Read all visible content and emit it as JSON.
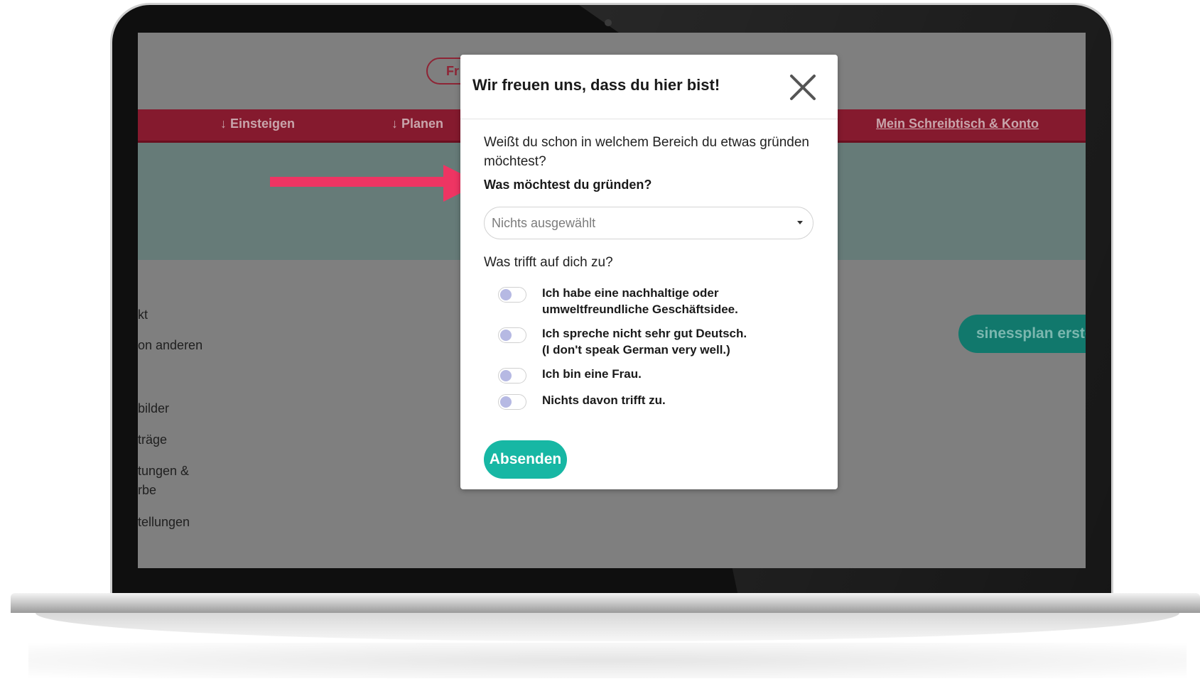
{
  "background_page": {
    "pill_fragment": "Fr",
    "nav": {
      "einsteigen": "↓ Einsteigen",
      "planen": "↓ Planen",
      "account": "Mein Schreibtisch & Konto"
    },
    "side_texts": [
      "kt",
      "on anderen",
      "bilder",
      "träge",
      "tungen &",
      "rbe",
      "tellungen"
    ],
    "cta_fragment": "sinessplan erstellen"
  },
  "modal": {
    "title": "Wir freuen uns, dass du hier bist!",
    "question": "Weißt du schon in welchem Bereich du etwas gründen möchtest?",
    "select_label": "Was möchtest du gründen?",
    "select_value": "Nichts ausgewählt",
    "section_label": "Was trifft auf dich zu?",
    "options": [
      "Ich habe eine nachhaltige oder\numweltfreundliche Geschäftsidee.",
      "Ich spreche nicht sehr gut Deutsch.\n(I don't speak German very well.)",
      "Ich bin eine Frau.",
      "Nichts davon trifft zu."
    ],
    "submit_label": "Absenden"
  },
  "colors": {
    "nav_bar": "#851a2e",
    "accent_teal": "#17b7a4",
    "annotation_arrow": "#ee3563"
  }
}
